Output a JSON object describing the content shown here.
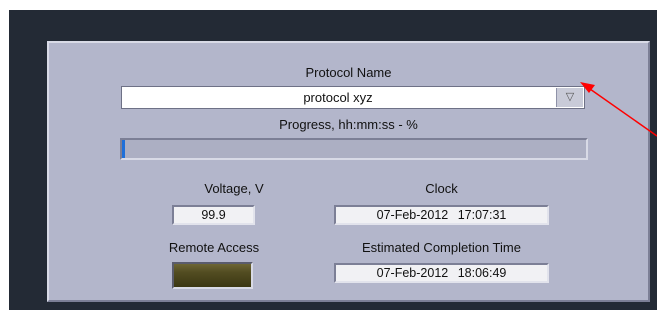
{
  "protocol": {
    "label": "Protocol Name",
    "selected": "protocol xyz"
  },
  "progress": {
    "label": "Progress, hh:mm:ss - %",
    "fraction": 0.006,
    "fill_color": "#1e6fd9"
  },
  "voltage": {
    "label": "Voltage, V",
    "value": "99.9"
  },
  "clock": {
    "label": "Clock",
    "value": "07-Feb-2012   17:07:31"
  },
  "remote_access": {
    "label": "Remote Access",
    "indicator_state": "off"
  },
  "completion": {
    "label": "Estimated Completion Time",
    "value": "07-Feb-2012   18:06:49"
  },
  "icons": {
    "dropdown": "triangle-down-icon",
    "annotation": "red-arrow-annotation"
  },
  "colors": {
    "panel": "#b3b6cb",
    "background": "#232a35",
    "annotation": "#ff0000"
  }
}
